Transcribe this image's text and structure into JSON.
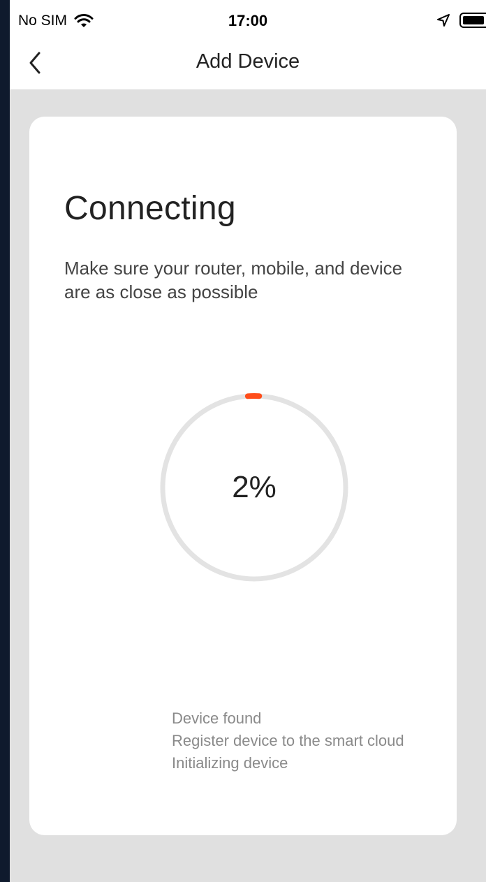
{
  "status_bar": {
    "carrier": "No SIM",
    "time": "17:00",
    "icons": [
      "wifi-icon",
      "location-arrow-icon",
      "battery-icon"
    ]
  },
  "nav": {
    "title": "Add Device",
    "back_icon": "chevron-left-icon"
  },
  "card": {
    "heading": "Connecting",
    "subtitle": "Make sure your router, mobile, and device are as close as possible",
    "progress": {
      "label": "2%",
      "value_percent": 2
    },
    "steps": [
      "Device found",
      "Register device to the smart cloud",
      "Initializing device"
    ]
  },
  "colors": {
    "accent": "#ff4d1a",
    "track": "#e3e3e3",
    "page_background": "#e0e0e0",
    "card_background": "#ffffff"
  }
}
